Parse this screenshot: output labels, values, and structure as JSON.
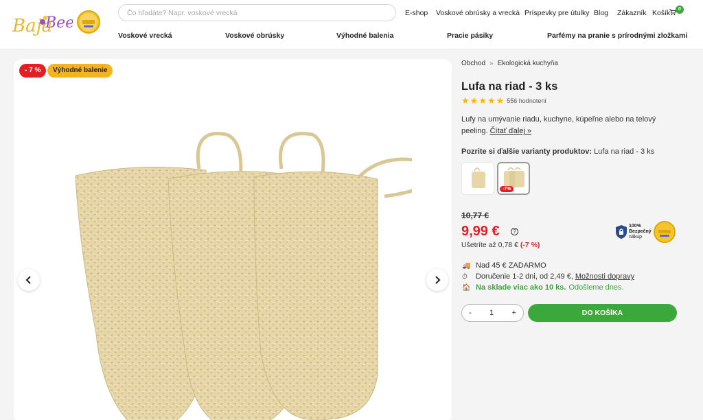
{
  "brand": {
    "name_part1": "Baja",
    "name_part2": "Bee"
  },
  "search": {
    "placeholder": "Čo hľadáte? Napr. voskové vrecká"
  },
  "top_nav": [
    "E-shop",
    "Voskové obrúsky a vrecká",
    "Príspevky pre útulky",
    "Blog",
    "Zákazník",
    "Košík"
  ],
  "cart": {
    "count": "0"
  },
  "category_nav": [
    "Voskové vrecká",
    "Voskové obrúsky",
    "Výhodné balenia",
    "Pracie pásiky",
    "Parfémy na pranie s prírodnými zložkami"
  ],
  "gallery": {
    "badge_discount": "- 7 %",
    "badge_offer": "Výhodné balenie",
    "prev_icon": "chevron-left-icon",
    "next_icon": "chevron-right-icon"
  },
  "breadcrumb": {
    "items": [
      "Obchod",
      "Ekologická kuchyňa"
    ],
    "separator": "»"
  },
  "product": {
    "title": "Lufa na riad - 3 ks",
    "rating": 5,
    "rating_count": "556 hodnotení",
    "description": "Lufy na umývanie riadu, kuchyne, kúpeľne alebo na telový peeling.",
    "read_more": "Čítať ďalej »",
    "variants_label": "Pozrite si ďalšie varianty produktov:",
    "variants_selected": "Lufa na riad - 3 ks",
    "variant_badge": "-7%",
    "old_price": "10,77 €",
    "price": "9,99 €",
    "savings_text": "Ušetríte až 0,78 €",
    "savings_pct": "(-7 %)",
    "secure_title": "100%",
    "secure_line1": "Bezpečný",
    "secure_line2": "nákup"
  },
  "info": {
    "free_shipping": "Nad 45 € ZADARMO",
    "delivery": "Doručenie 1-2 dni, od 2,49 €,",
    "delivery_link": "Možnosti dopravy",
    "stock": "Na sklade viac ako 10 ks.",
    "ship_today": "Odošleme dnes."
  },
  "cart_controls": {
    "minus": "-",
    "qty": "1",
    "plus": "+",
    "add_label": "DO KOŠÍKA"
  },
  "colors": {
    "accent_green": "#3aa83a",
    "sale_red": "#e31e24",
    "offer_yellow": "#f5b324"
  }
}
